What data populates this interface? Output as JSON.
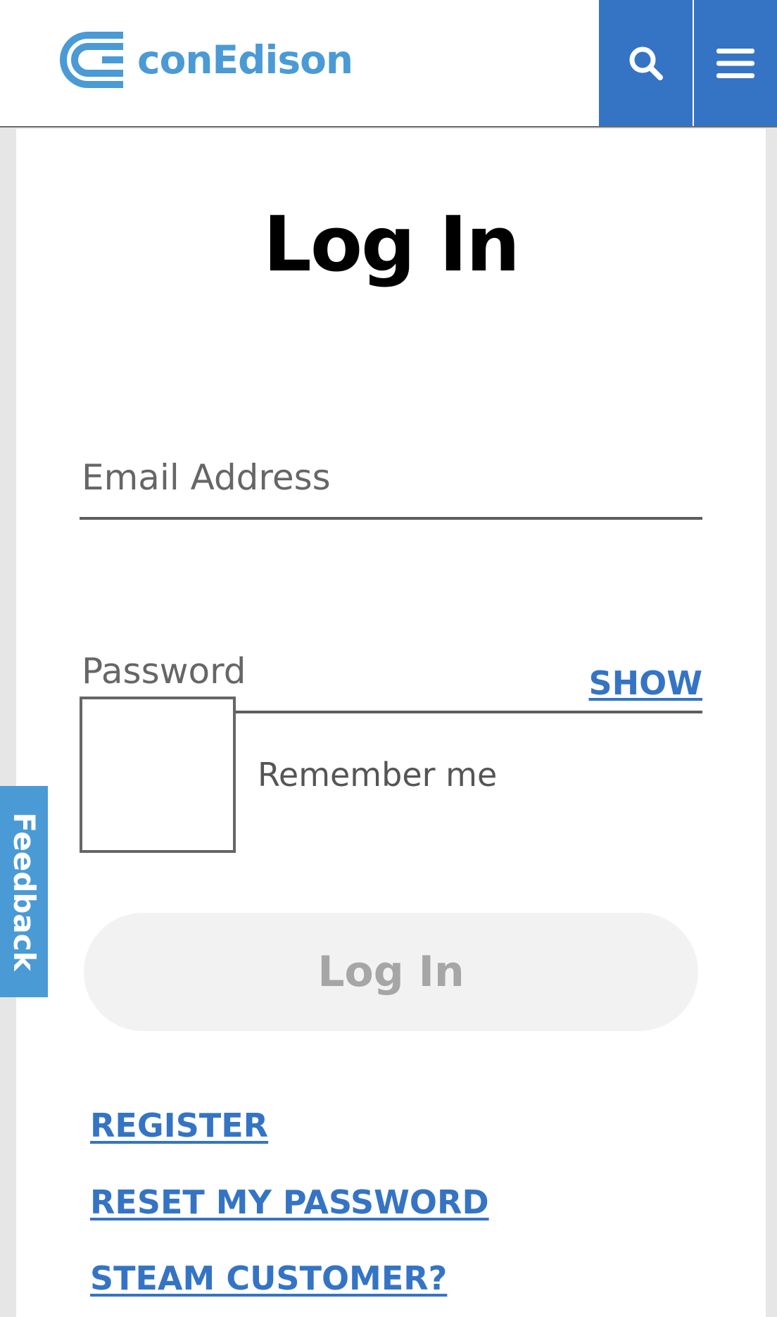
{
  "header": {
    "brand_name": "conEdison",
    "search_icon": "search-icon",
    "menu_icon": "hamburger-menu-icon"
  },
  "colors": {
    "brand_blue": "#4a9ad6",
    "header_button_blue": "#3574c4",
    "link_blue": "#3574c4",
    "disabled_button_bg": "#f2f2f2",
    "disabled_button_text": "#a6a6a6",
    "page_gutter": "#e6e6e6"
  },
  "login": {
    "title": "Log In",
    "email_label": "Email Address",
    "email_value": "",
    "password_label": "Password",
    "password_value": "",
    "show_label": "SHOW",
    "remember_label": "Remember me",
    "remember_checked": false,
    "submit_label": "Log In"
  },
  "links": {
    "register": "REGISTER",
    "reset_password": "RESET MY PASSWORD",
    "steam_customer": "STEAM CUSTOMER?"
  },
  "feedback": {
    "label": "Feedback"
  }
}
